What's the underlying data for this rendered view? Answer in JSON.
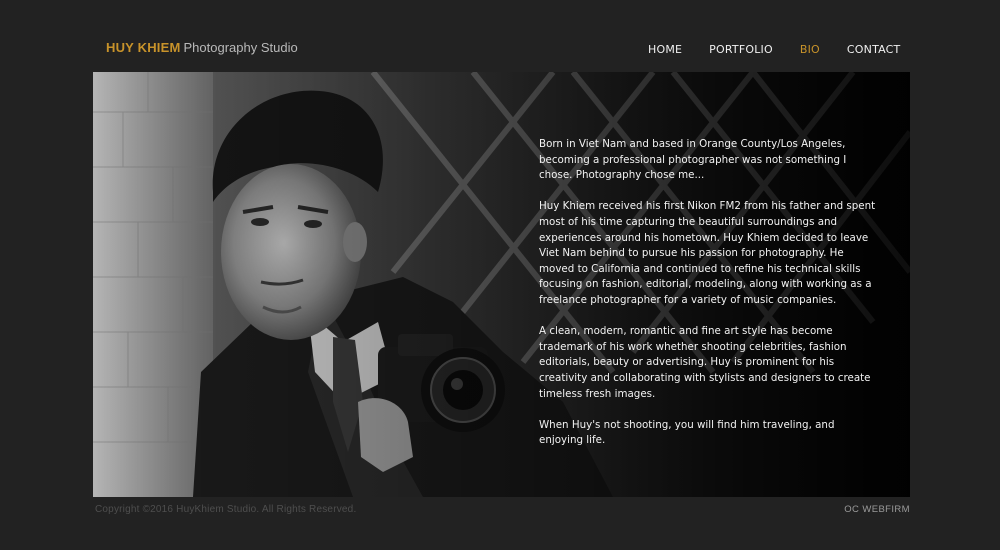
{
  "header": {
    "brand": "HUY KHIEM",
    "studio": "Photography Studio"
  },
  "nav": {
    "items": [
      {
        "label": "HOME",
        "active": false
      },
      {
        "label": "PORTFOLIO",
        "active": false
      },
      {
        "label": "BIO",
        "active": true
      },
      {
        "label": "CONTACT",
        "active": false
      }
    ]
  },
  "bio": {
    "paragraphs": [
      "Born in Viet Nam and based in Orange County/Los Angeles, becoming a professional photographer was not something I chose. Photography chose me...",
      "Huy Khiem received his first Nikon FM2 from his father and spent most of his time capturing the beautiful surroundings and experiences around his hometown. Huy Khiem decided to leave Viet Nam behind to pursue his passion for photography. He moved to California and continued to refine his technical skills focusing on fashion, editorial, modeling, along with working as a freelance photographer for a variety of music companies.",
      "A clean, modern, romantic and fine art style has become trademark of his work whether shooting celebrities, fashion editorials, beauty or advertising. Huy is prominent for his creativity and collaborating with stylists and designers to create timeless fresh images.",
      "When Huy's not shooting, you will find him traveling, and enjoying life."
    ]
  },
  "footer": {
    "copyright": "Copyright ©2016 HuyKhiem Studio. All Rights Reserved.",
    "credit": "OC WEBFIRM"
  },
  "colors": {
    "background": "#222222",
    "accent": "#c8932a",
    "nav_text": "#f0f0f0"
  }
}
